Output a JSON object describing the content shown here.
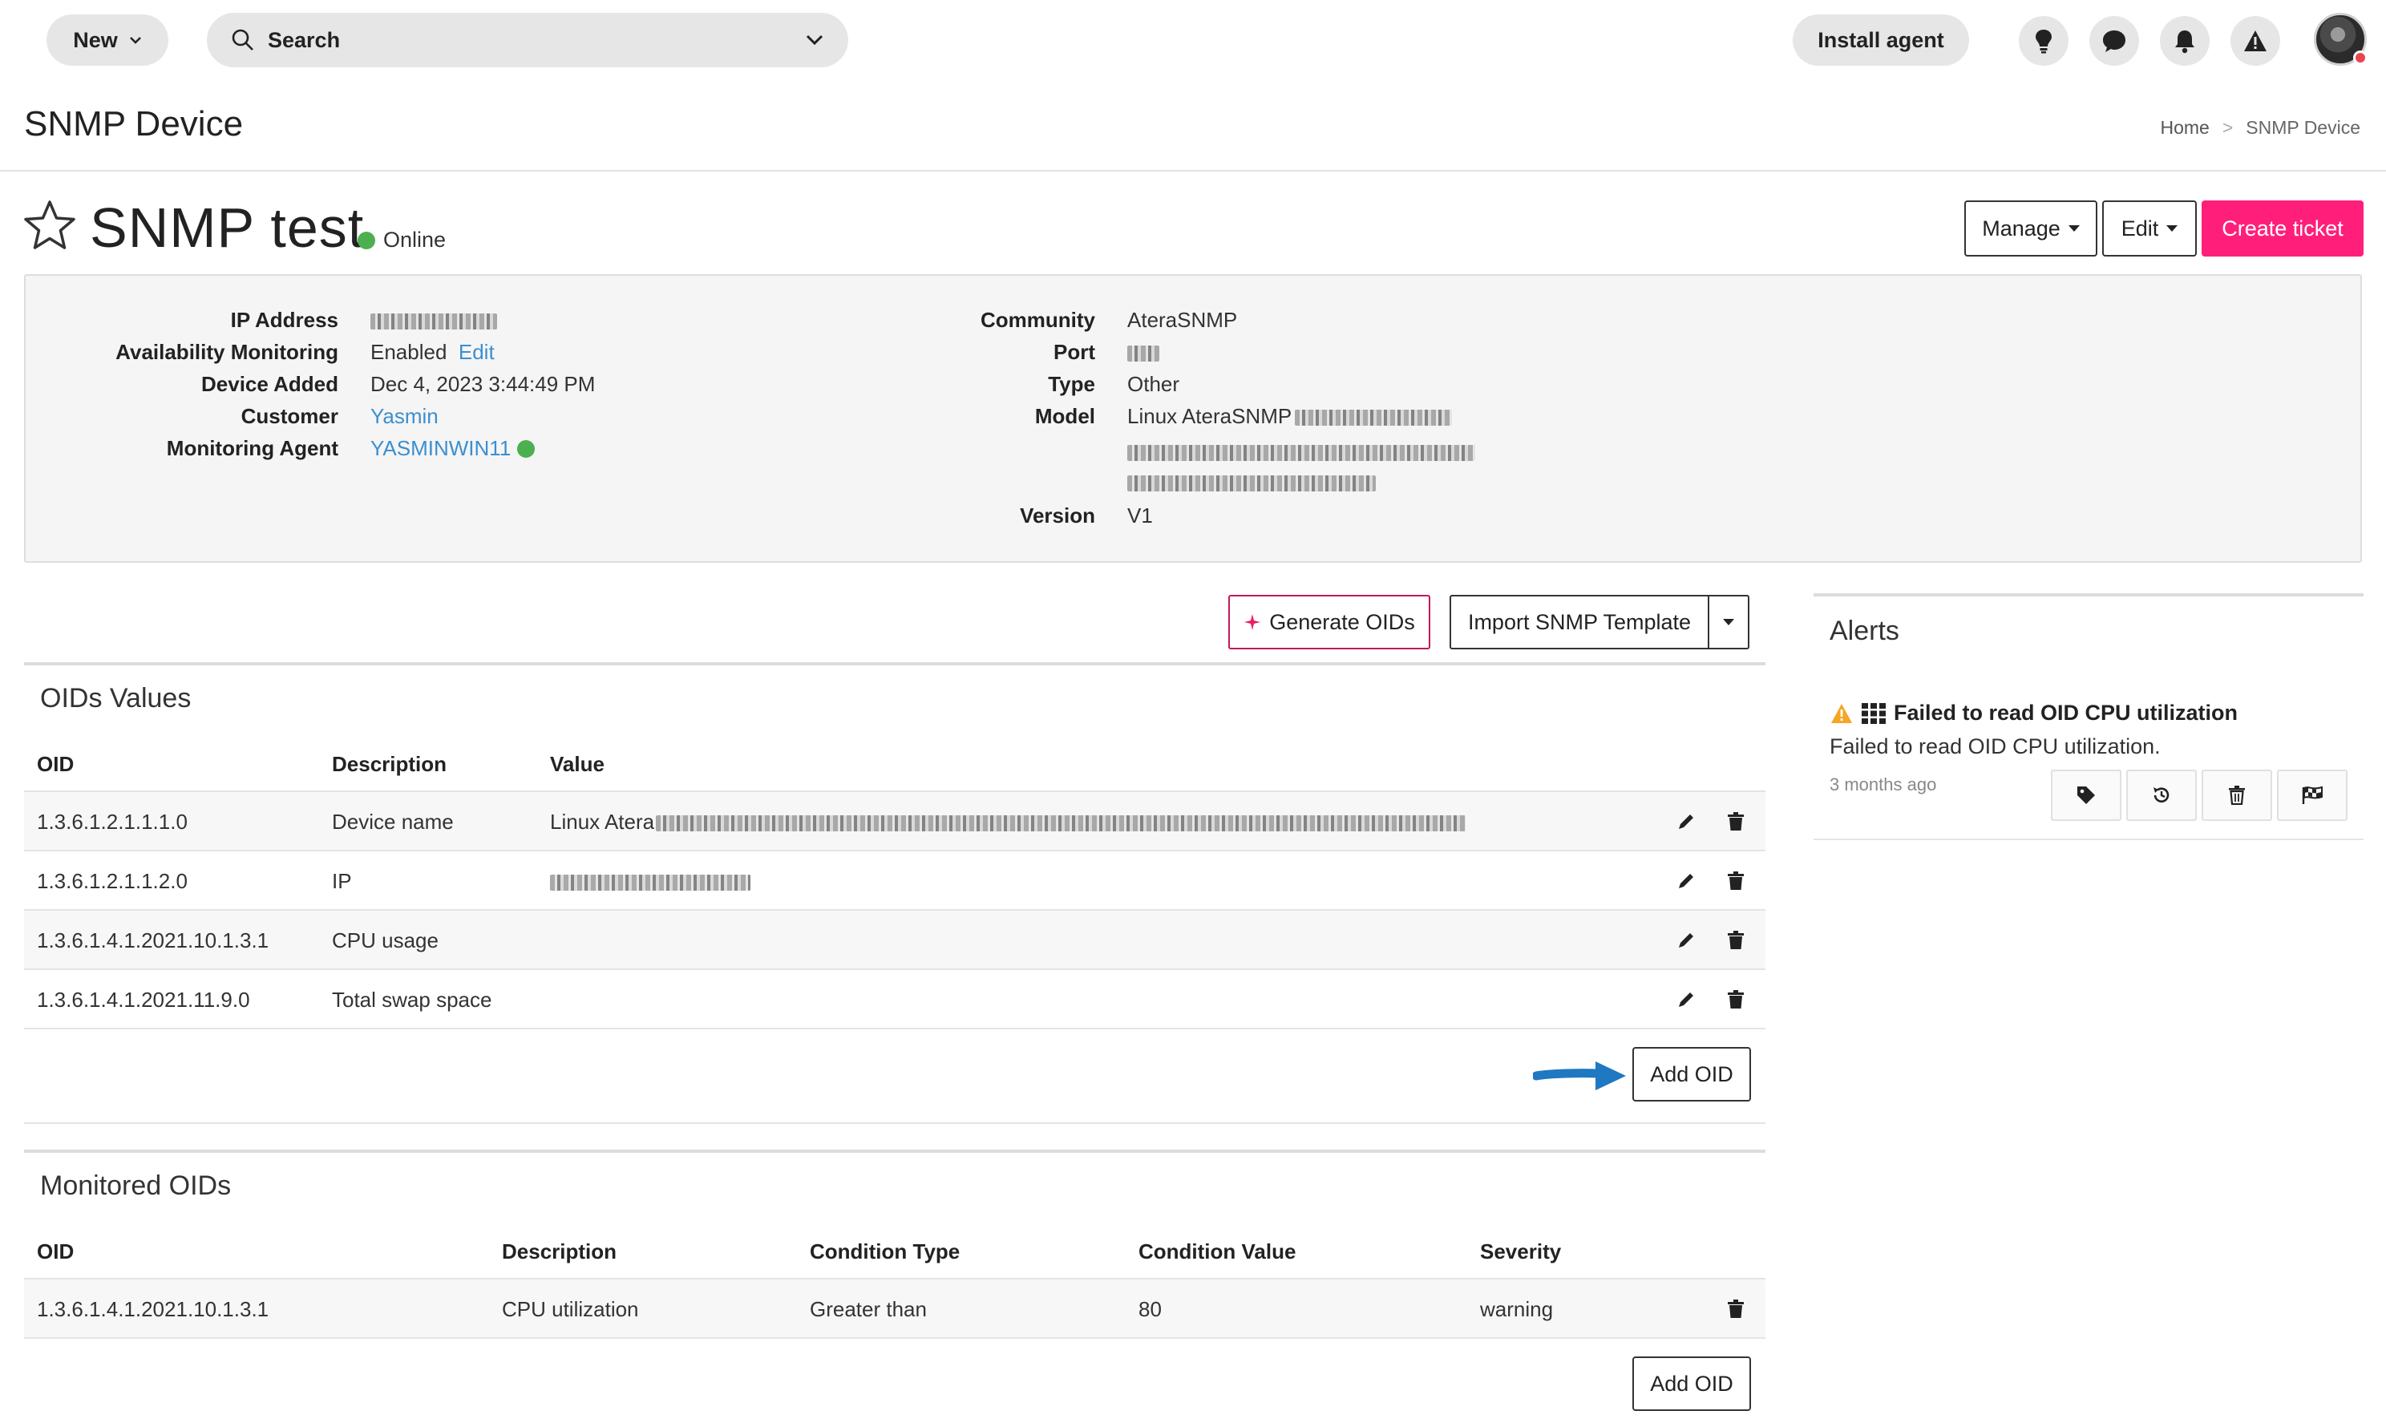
{
  "topbar": {
    "new_label": "New",
    "search_label": "Search",
    "install_label": "Install agent",
    "icons": [
      "lightbulb-icon",
      "chat-icon",
      "bell-icon",
      "warning-icon"
    ]
  },
  "page": {
    "title": "SNMP Device",
    "breadcrumb": {
      "home": "Home",
      "separator": ">",
      "current": "SNMP Device"
    }
  },
  "device": {
    "name": "SNMP test",
    "status": "Online",
    "status_color": "#4caf50"
  },
  "actions": {
    "manage_label": "Manage",
    "edit_label": "Edit",
    "ticket_label": "Create ticket",
    "ticket_color": "#ff1f7a"
  },
  "info_left": {
    "ip_label": "IP Address",
    "availability_label": "Availability Monitoring",
    "availability_value": "Enabled",
    "availability_edit": "Edit",
    "added_label": "Device Added",
    "added_value": "Dec 4, 2023 3:44:49 PM",
    "customer_label": "Customer",
    "customer_value": "Yasmin",
    "agent_label": "Monitoring Agent",
    "agent_value": "YASMINWIN11"
  },
  "info_right": {
    "community_label": "Community",
    "community_value": "AteraSNMP",
    "port_label": "Port",
    "type_label": "Type",
    "type_value": "Other",
    "model_label": "Model",
    "model_value": "Linux AteraSNMP",
    "version_label": "Version",
    "version_value": "V1"
  },
  "oid_toolbar": {
    "generate_label": "Generate OIDs",
    "import_label": "Import SNMP Template"
  },
  "oids_values": {
    "title": "OIDs Values",
    "headers": {
      "oid": "OID",
      "description": "Description",
      "value": "Value"
    },
    "rows": [
      {
        "oid": "1.3.6.1.2.1.1.1.0",
        "description": "Device name",
        "value": "Linux Atera"
      },
      {
        "oid": "1.3.6.1.2.1.1.2.0",
        "description": "IP",
        "value": ""
      },
      {
        "oid": "1.3.6.1.4.1.2021.10.1.3.1",
        "description": "CPU usage",
        "value": ""
      },
      {
        "oid": "1.3.6.1.4.1.2021.11.9.0",
        "description": "Total swap space",
        "value": ""
      }
    ],
    "add_label": "Add OID"
  },
  "monitored_oids": {
    "title": "Monitored OIDs",
    "headers": {
      "oid": "OID",
      "description": "Description",
      "condition_type": "Condition Type",
      "condition_value": "Condition Value",
      "severity": "Severity"
    },
    "rows": [
      {
        "oid": "1.3.6.1.4.1.2021.10.1.3.1",
        "description": "CPU utilization",
        "condition_type": "Greater than",
        "condition_value": "80",
        "severity": "warning"
      }
    ],
    "add_label": "Add OID"
  },
  "alerts": {
    "title": "Alerts",
    "items": [
      {
        "title": "Failed to read OID CPU utilization",
        "body": "Failed to read OID CPU utilization.",
        "time": "3 months ago"
      }
    ]
  },
  "colors": {
    "link": "#3b8fd0",
    "accent_arrow": "#1f78c1",
    "warning": "#f5a623"
  }
}
